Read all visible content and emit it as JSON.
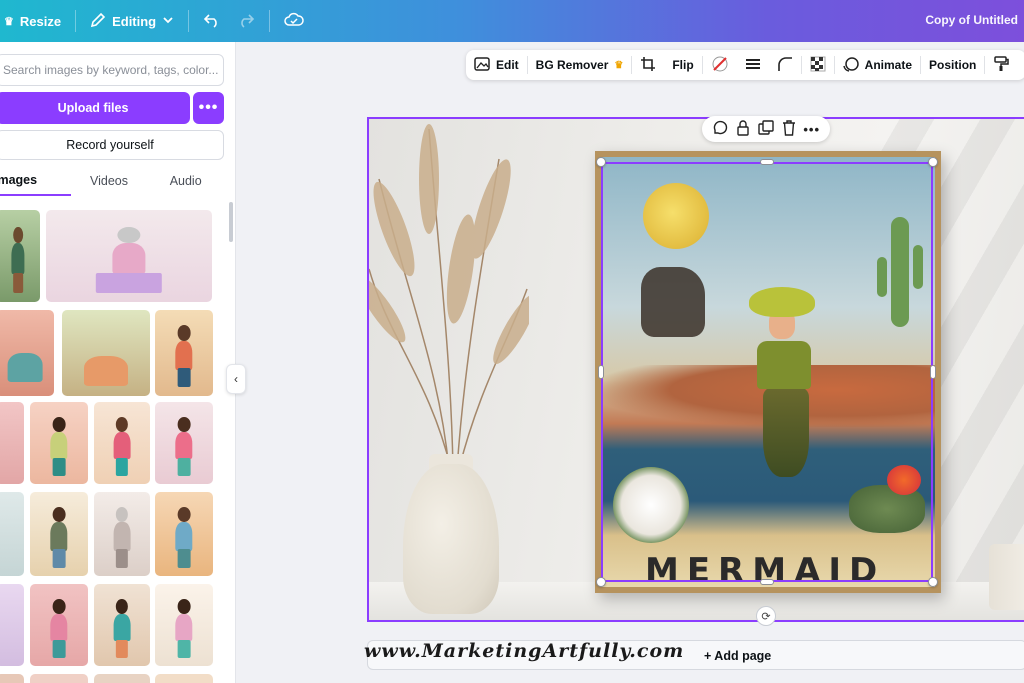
{
  "topbar": {
    "resize_label": "Resize",
    "editing_label": "Editing",
    "title": "Copy of Untitled"
  },
  "panel": {
    "search_placeholder": "Search images by keyword, tags, color...",
    "upload_label": "Upload files",
    "more_label": "•••",
    "record_label": "Record yourself",
    "tabs": [
      {
        "label": "Images",
        "active": true
      },
      {
        "label": "Videos",
        "active": false
      },
      {
        "label": "Audio",
        "active": false
      }
    ]
  },
  "editor_toolbar": {
    "edit": "Edit",
    "bg_remover": "BG Remover",
    "flip": "Flip",
    "animate": "Animate",
    "position": "Position"
  },
  "artwork": {
    "caption": "MERMAID"
  },
  "canvas": {
    "add_page_label": "+ Add page"
  },
  "watermark": {
    "text": "www.MarketingArtfully.com"
  },
  "colors": {
    "accent": "#8b3dff",
    "topbar_gradient_start": "#1fb8cf",
    "topbar_gradient_end": "#7d4fdc"
  }
}
